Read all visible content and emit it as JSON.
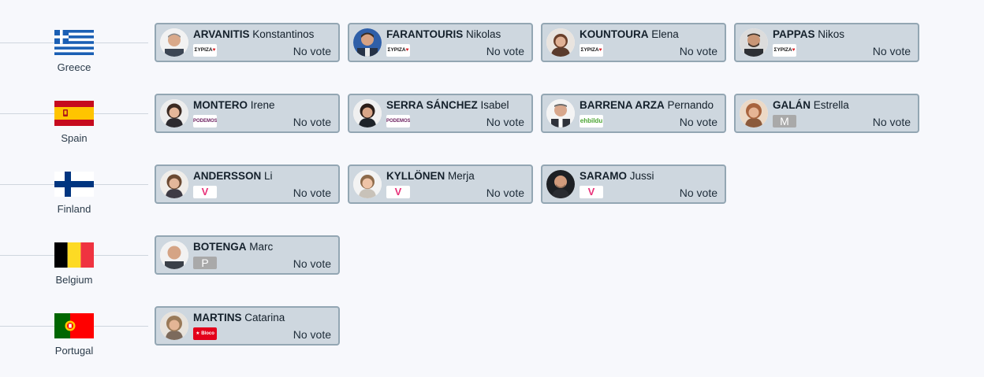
{
  "colors": {
    "background": "#f7f8fc",
    "card_bg": "#ced7df",
    "card_border": "#93a6b3"
  },
  "countries": [
    {
      "name": "Greece",
      "flag": "greece-flag",
      "meps": [
        {
          "surname": "ARVANITIS",
          "firstname": "Konstantinos",
          "party_logo": "syriza-logo",
          "party_text": "ΣΥΡΙΖΑ",
          "vote": "No vote"
        },
        {
          "surname": "FARANTOURIS",
          "firstname": "Nikolas",
          "party_logo": "syriza-logo",
          "party_text": "ΣΥΡΙΖΑ",
          "vote": "No vote"
        },
        {
          "surname": "KOUNTOURA",
          "firstname": "Elena",
          "party_logo": "syriza-logo",
          "party_text": "ΣΥΡΙΖΑ",
          "vote": "No vote"
        },
        {
          "surname": "PAPPAS",
          "firstname": "Nikos",
          "party_logo": "syriza-logo",
          "party_text": "ΣΥΡΙΖΑ",
          "vote": "No vote"
        }
      ]
    },
    {
      "name": "Spain",
      "flag": "spain-flag",
      "meps": [
        {
          "surname": "MONTERO",
          "firstname": "Irene",
          "party_logo": "podemos-logo",
          "party_text": "PODEMOS",
          "vote": "No vote"
        },
        {
          "surname": "SERRA SÁNCHEZ",
          "firstname": "Isabel",
          "party_logo": "podemos-logo",
          "party_text": "PODEMOS",
          "vote": "No vote"
        },
        {
          "surname": "BARRENA ARZA",
          "firstname": "Pernando",
          "party_logo": "ehbildu-logo",
          "party_text": "ehbildu",
          "vote": "No vote"
        },
        {
          "surname": "GALÁN",
          "firstname": "Estrella",
          "party_logo": "generic-party-logo",
          "party_text": "M",
          "vote": "No vote"
        }
      ]
    },
    {
      "name": "Finland",
      "flag": "finland-flag",
      "meps": [
        {
          "surname": "ANDERSSON",
          "firstname": "Li",
          "party_logo": "vasemmisto-logo",
          "party_text": "V",
          "vote": "No vote"
        },
        {
          "surname": "KYLLÖNEN",
          "firstname": "Merja",
          "party_logo": "vasemmisto-logo",
          "party_text": "V",
          "vote": "No vote"
        },
        {
          "surname": "SARAMO",
          "firstname": "Jussi",
          "party_logo": "vasemmisto-logo",
          "party_text": "V",
          "vote": "No vote"
        }
      ]
    },
    {
      "name": "Belgium",
      "flag": "belgium-flag",
      "meps": [
        {
          "surname": "BOTENGA",
          "firstname": "Marc",
          "party_logo": "generic-party-logo",
          "party_text": "P",
          "vote": "No vote"
        }
      ]
    },
    {
      "name": "Portugal",
      "flag": "portugal-flag",
      "meps": [
        {
          "surname": "MARTINS",
          "firstname": "Catarina",
          "party_logo": "bloco-logo",
          "party_text": "Bloco",
          "vote": "No vote"
        }
      ]
    }
  ]
}
